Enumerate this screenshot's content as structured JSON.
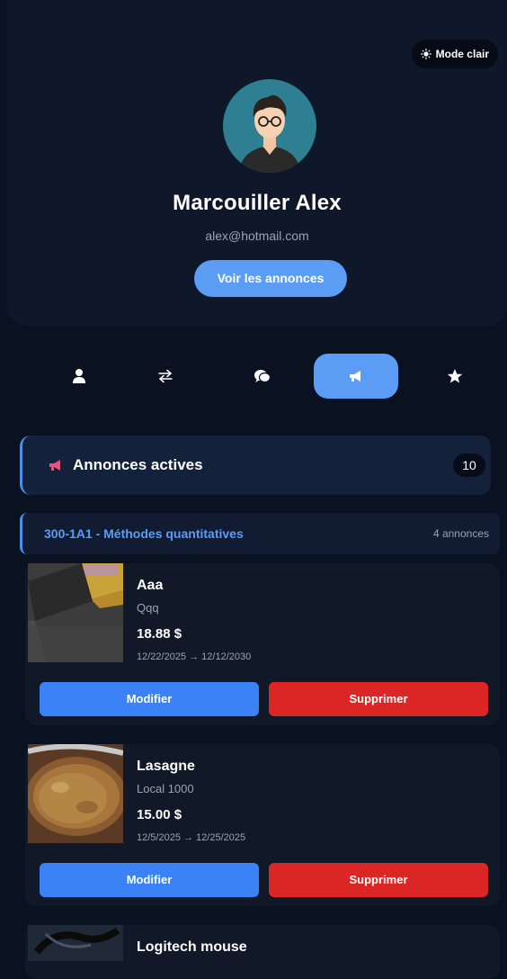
{
  "header": {
    "mode_toggle_label": "Mode clair",
    "name": "Marcouiller Alex",
    "email": "alex@hotmail.com",
    "view_button": "Voir les annonces"
  },
  "tabs": [
    {
      "icon": "user-icon",
      "active": false
    },
    {
      "icon": "swap-arrows-icon",
      "active": false
    },
    {
      "icon": "chat-bubbles-icon",
      "active": false
    },
    {
      "icon": "megaphone-icon",
      "active": true
    },
    {
      "icon": "star-icon",
      "active": false
    }
  ],
  "active_section": {
    "icon": "megaphone-icon",
    "title": "Annonces actives",
    "count": "10"
  },
  "course": {
    "title": "300-1A1 - Méthodes quantitatives",
    "count_label": "4 annonces"
  },
  "listings": [
    {
      "title": "Aaa",
      "subtitle": "Qqq",
      "price": "18.88 $",
      "dates": "12/22/2025 → 12/12/2030",
      "edit_label": "Modifier",
      "delete_label": "Supprimer"
    },
    {
      "title": "Lasagne",
      "subtitle": "Local 1000",
      "price": "15.00 $",
      "dates": "12/5/2025 → 12/25/2025",
      "edit_label": "Modifier",
      "delete_label": "Supprimer"
    },
    {
      "title": "Logitech mouse"
    }
  ],
  "colors": {
    "page_bg": "#0a1120",
    "card_bg": "#111827",
    "accent_blue": "#5b9cf5",
    "edit_blue": "#3b82f6",
    "delete_red": "#dc2626",
    "muted_text": "#9aa4b5"
  }
}
